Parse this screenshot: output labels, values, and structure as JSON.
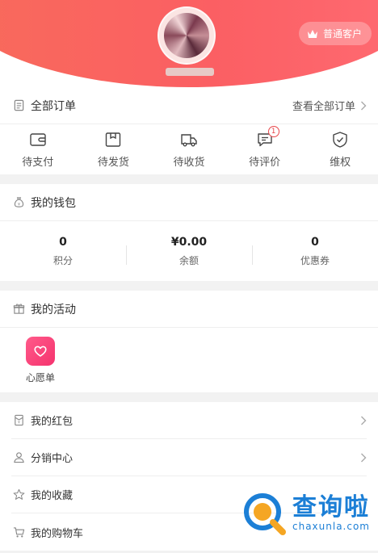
{
  "header": {
    "member_label": "普通客户",
    "accent": "#fb5f63"
  },
  "orders": {
    "title": "全部订单",
    "view_all": "查看全部订单",
    "items": [
      {
        "label": "待支付",
        "icon": "wallet-icon"
      },
      {
        "label": "待发货",
        "icon": "package-icon"
      },
      {
        "label": "待收货",
        "icon": "truck-icon"
      },
      {
        "label": "待评价",
        "icon": "comment-icon",
        "badge": "1"
      },
      {
        "label": "维权",
        "icon": "shield-icon"
      }
    ]
  },
  "wallet": {
    "title": "我的钱包",
    "items": [
      {
        "value": "0",
        "label": "积分"
      },
      {
        "value": "¥0.00",
        "label": "余额"
      },
      {
        "value": "0",
        "label": "优惠券"
      }
    ]
  },
  "activity": {
    "title": "我的活动",
    "items": [
      {
        "label": "心愿单",
        "icon": "heart-icon"
      }
    ]
  },
  "menu": {
    "items": [
      {
        "label": "我的红包",
        "icon": "red-envelope-icon"
      },
      {
        "label": "分销中心",
        "icon": "user-icon"
      },
      {
        "label": "我的收藏",
        "icon": "star-icon"
      },
      {
        "label": "我的购物车",
        "icon": "cart-icon"
      }
    ]
  },
  "watermark": {
    "cn": "查询啦",
    "en": "chaxunla.com"
  }
}
